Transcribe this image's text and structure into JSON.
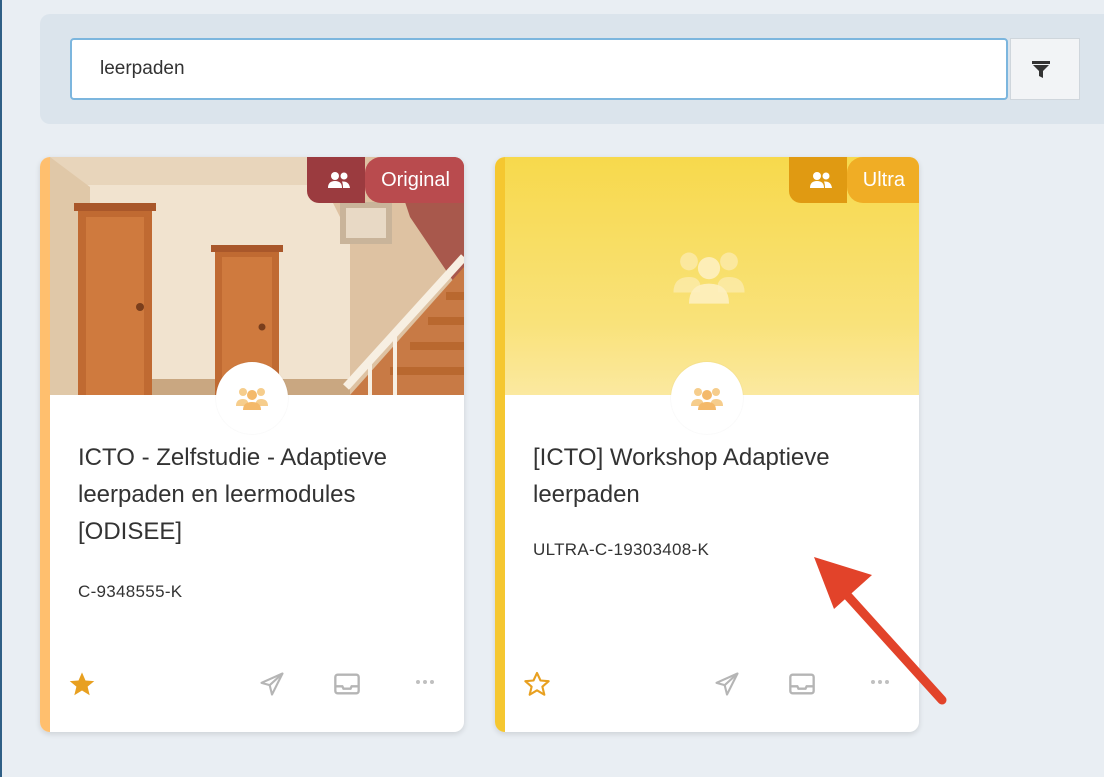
{
  "search": {
    "value": "leerpaden"
  },
  "courses": [
    {
      "badge": "Original",
      "title": "ICTO - Zelfstudie - Adaptieve leerpaden en leermodules [ODISEE]",
      "code": "C-9348555-K",
      "favorite": true
    },
    {
      "badge": "Ultra",
      "title": "[ICTO] Workshop Adaptieve leerpaden",
      "code": "ULTRA-C-19303408-K",
      "favorite": false
    }
  ],
  "colors": {
    "original_badge": "#9b3b3f",
    "original_badge_label": "#b94b4e",
    "original_stripe": "#ffbf6e",
    "ultra_badge": "#e09a12",
    "ultra_badge_label": "#f0ad25",
    "ultra_stripe": "#f5c730",
    "arrow": "#e2432a"
  }
}
